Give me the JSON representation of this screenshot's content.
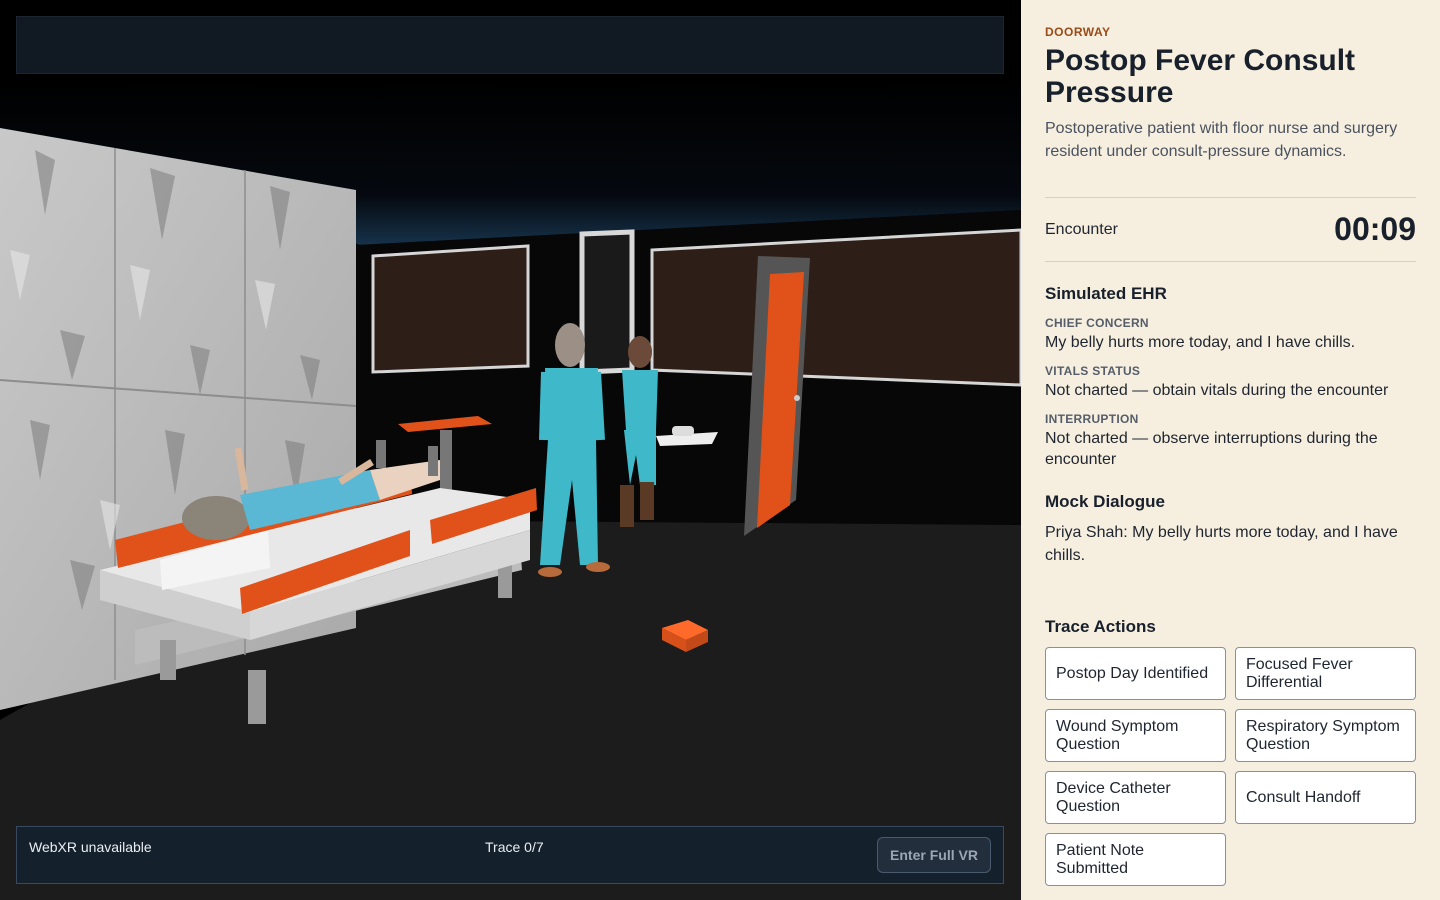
{
  "hud": {
    "webxr_status": "WebXR unavailable",
    "trace": "Trace 0/7",
    "vr_button": "Enter Full VR"
  },
  "scenario": {
    "eyebrow": "DOORWAY",
    "title": "Postop Fever Consult Pressure",
    "description": "Postoperative patient with floor nurse and surgery resident under consult-pressure dynamics."
  },
  "encounter": {
    "label": "Encounter",
    "timer": "00:09"
  },
  "ehr": {
    "title": "Simulated EHR",
    "chief_concern_label": "CHIEF CONCERN",
    "chief_concern": "My belly hurts more today, and I have chills.",
    "vitals_label": "VITALS STATUS",
    "vitals": "Not charted — obtain vitals during the encounter",
    "interruption_label": "INTERRUPTION",
    "interruption": "Not charted — observe interruptions during the encounter"
  },
  "dialogue": {
    "title": "Mock Dialogue",
    "text": "Priya Shah: My belly hurts more today, and I have chills."
  },
  "trace_actions": {
    "title": "Trace Actions",
    "buttons": [
      "Postop Day Identified",
      "Focused Fever Differential",
      "Wound Symptom Question",
      "Respiratory Symptom Question",
      "Device Catheter Question",
      "Consult Handoff",
      "Patient Note Submitted"
    ]
  },
  "colors": {
    "panel_bg": "#f6efdf",
    "accent_orange": "#e8561c",
    "scrubs_teal": "#3fb9c9",
    "eyebrow": "#9a4a16"
  }
}
